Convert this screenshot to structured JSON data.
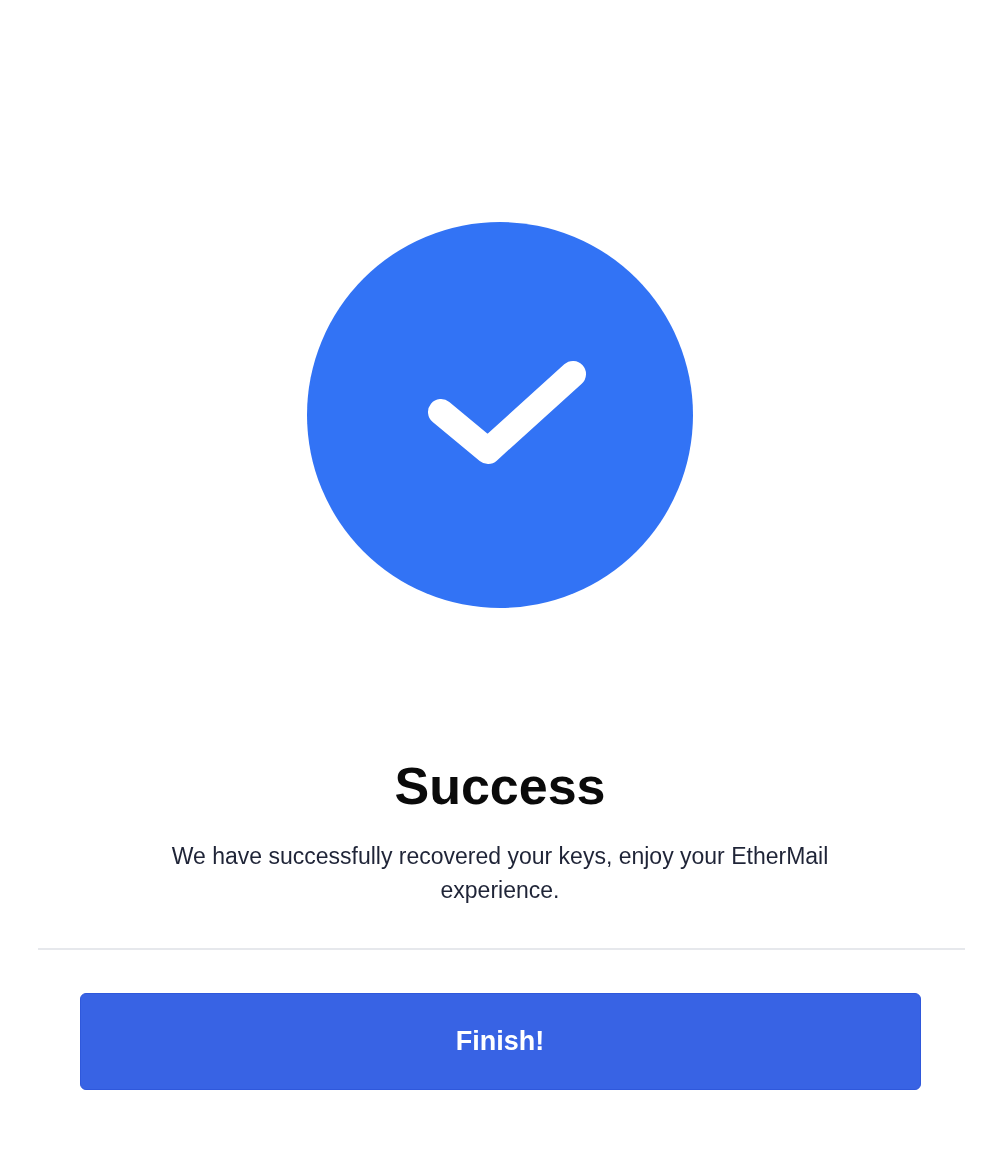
{
  "title": "Success",
  "message": "We have successfully recovered your keys, enjoy your EtherMail experience.",
  "button": {
    "label": "Finish!"
  }
}
